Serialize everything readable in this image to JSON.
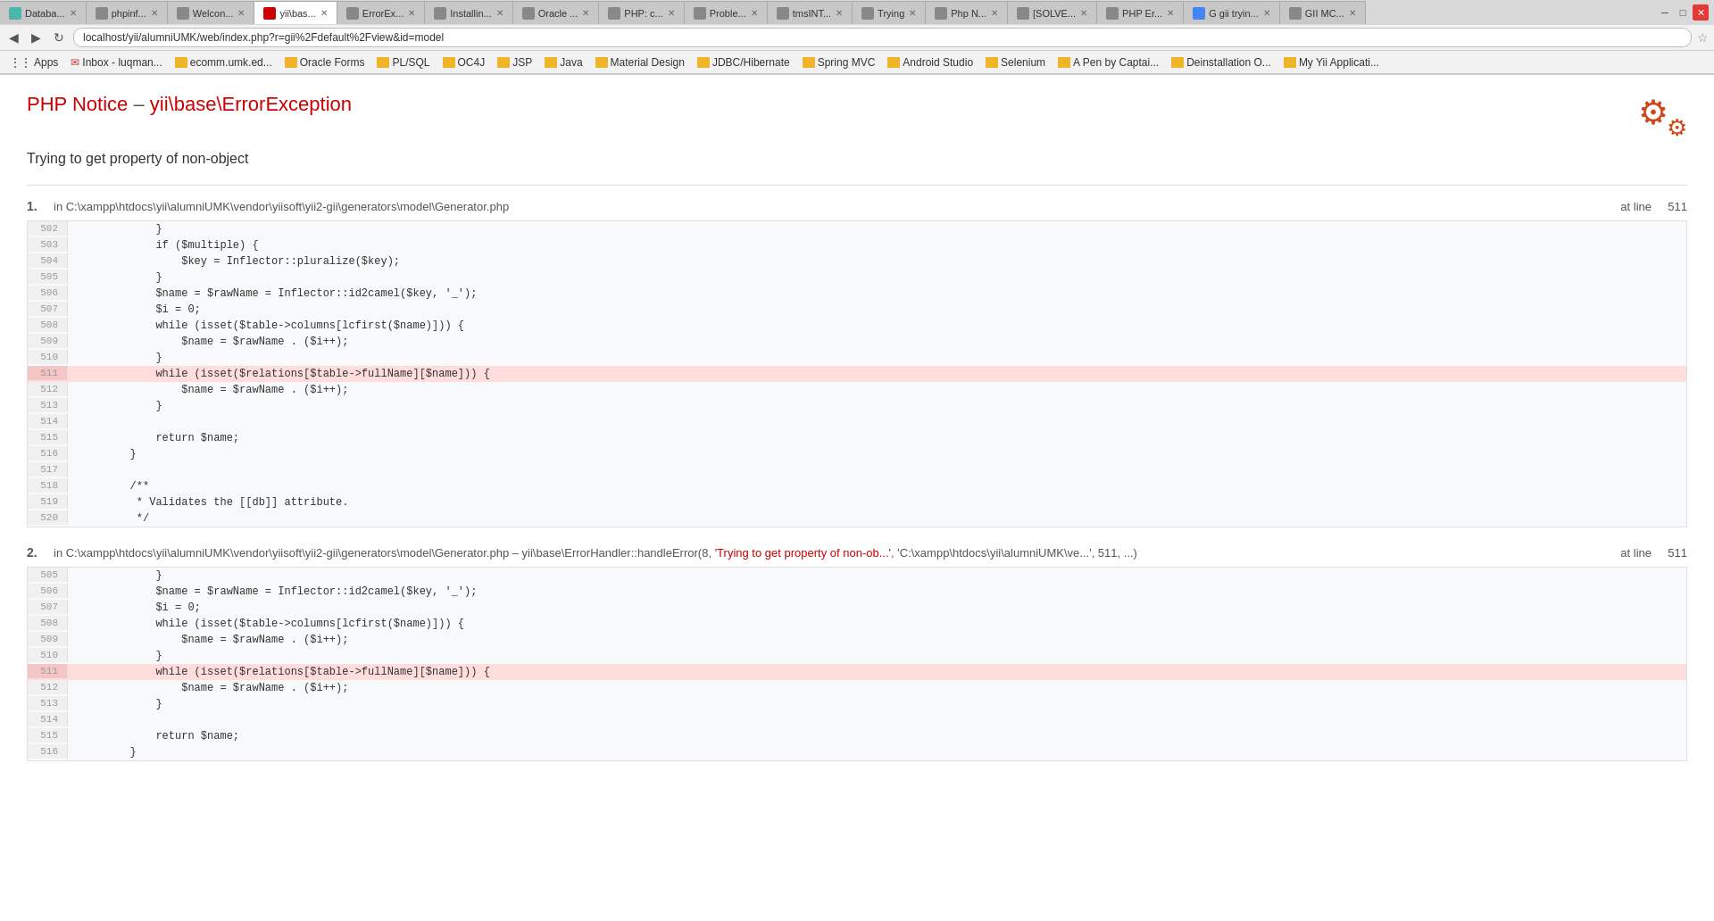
{
  "browser": {
    "url": "localhost/yii/alumniUMK/web/index.php?r=gii%2Fdefault%2Fview&id=model",
    "tabs": [
      {
        "label": "Databa...",
        "active": false,
        "color": "#4db6ac"
      },
      {
        "label": "phpinf...",
        "active": false,
        "color": "#888"
      },
      {
        "label": "Welcon...",
        "active": false,
        "color": "#888"
      },
      {
        "label": "yii\\bas...",
        "active": true,
        "color": "#cc0000"
      },
      {
        "label": "ErrorEx...",
        "active": false,
        "color": "#888"
      },
      {
        "label": "Installin...",
        "active": false,
        "color": "#888"
      },
      {
        "label": "Oracle ...",
        "active": false,
        "color": "#888"
      },
      {
        "label": "PHP: c...",
        "active": false,
        "color": "#888"
      },
      {
        "label": "Proble...",
        "active": false,
        "color": "#888"
      },
      {
        "label": "tmsINT...",
        "active": false,
        "color": "#888"
      },
      {
        "label": "Trying",
        "active": false,
        "color": "#888"
      },
      {
        "label": "Php N...",
        "active": false,
        "color": "#888"
      },
      {
        "label": "[SOLVE...",
        "active": false,
        "color": "#888"
      },
      {
        "label": "PHP Er...",
        "active": false,
        "color": "#888"
      },
      {
        "label": "G gii tryin...",
        "active": false,
        "color": "#888"
      },
      {
        "label": "GII MC...",
        "active": false,
        "color": "#888"
      }
    ],
    "bookmarks": [
      {
        "label": "Apps",
        "type": "text"
      },
      {
        "label": "Inbox - luqman...",
        "type": "mail"
      },
      {
        "label": "ecomm.umk.ed...",
        "type": "folder"
      },
      {
        "label": "Oracle Forms",
        "type": "folder"
      },
      {
        "label": "PL/SQL",
        "type": "folder"
      },
      {
        "label": "OC4J",
        "type": "folder"
      },
      {
        "label": "JSP",
        "type": "folder"
      },
      {
        "label": "Java",
        "type": "folder"
      },
      {
        "label": "Material Design",
        "type": "folder"
      },
      {
        "label": "JDBC/Hibernate",
        "type": "folder"
      },
      {
        "label": "Spring MVC",
        "type": "folder"
      },
      {
        "label": "Android Studio",
        "type": "folder"
      },
      {
        "label": "Selenium",
        "type": "folder"
      },
      {
        "label": "A Pen by Captai...",
        "type": "folder"
      },
      {
        "label": "Deinstallation O...",
        "type": "folder"
      },
      {
        "label": "My Yii Applicati...",
        "type": "folder"
      }
    ]
  },
  "page": {
    "error_title_prefix": "PHP Notice",
    "error_title_dash": " – ",
    "error_title_exception": "yii\\base\\ErrorException",
    "error_message": "Trying to get property of non-object",
    "stack_items": [
      {
        "number": "1.",
        "file": "in C:\\xampp\\htdocs\\yii\\alumniUMK\\vendor\\yiisoft\\yii2-gii\\generators\\model\\Generator.php",
        "at_line_label": "at line",
        "line_number": "511",
        "function_call": null,
        "code_lines": [
          {
            "num": "502",
            "content": "            }",
            "highlight": false
          },
          {
            "num": "503",
            "content": "            if ($multiple) {",
            "highlight": false
          },
          {
            "num": "504",
            "content": "                $key = Inflector::pluralize($key);",
            "highlight": false
          },
          {
            "num": "505",
            "content": "            }",
            "highlight": false
          },
          {
            "num": "506",
            "content": "            $name = $rawName = Inflector::id2camel($key, '_');",
            "highlight": false
          },
          {
            "num": "507",
            "content": "            $i = 0;",
            "highlight": false
          },
          {
            "num": "508",
            "content": "            while (isset($table->columns[lcfirst($name)])) {",
            "highlight": false
          },
          {
            "num": "509",
            "content": "                $name = $rawName . ($i++);",
            "highlight": false
          },
          {
            "num": "510",
            "content": "            }",
            "highlight": false
          },
          {
            "num": "511",
            "content": "            while (isset($relations[$table->fullName][$name])) {",
            "highlight": true
          },
          {
            "num": "512",
            "content": "                $name = $rawName . ($i++);",
            "highlight": false
          },
          {
            "num": "513",
            "content": "            }",
            "highlight": false
          },
          {
            "num": "514",
            "content": "",
            "highlight": false
          },
          {
            "num": "515",
            "content": "            return $name;",
            "highlight": false
          },
          {
            "num": "516",
            "content": "        }",
            "highlight": false
          },
          {
            "num": "517",
            "content": "",
            "highlight": false
          },
          {
            "num": "518",
            "content": "        /**",
            "highlight": false
          },
          {
            "num": "519",
            "content": "         * Validates the [[db]] attribute.",
            "highlight": false
          },
          {
            "num": "520",
            "content": "         */",
            "highlight": false
          }
        ]
      },
      {
        "number": "2.",
        "file": "in C:\\xampp\\htdocs\\yii\\alumniUMK\\vendor\\yiisoft\\yii2-gii\\generators\\model\\Generator.php",
        "separator": " – ",
        "function_call": "yii\\base\\ErrorHandler::handleError(8, 'Trying to get property of non-ob...', 'C:\\xampp\\htdocs\\yii\\alumniUMK\\ve...', 511, ...)",
        "function_call_error_text": "'Trying to get property of non-ob...'",
        "at_line_label": "at line",
        "line_number": "511",
        "code_lines": [
          {
            "num": "505",
            "content": "            }",
            "highlight": false
          },
          {
            "num": "506",
            "content": "            $name = $rawName = Inflector::id2camel($key, '_');",
            "highlight": false
          },
          {
            "num": "507",
            "content": "            $i = 0;",
            "highlight": false
          },
          {
            "num": "508",
            "content": "            while (isset($table->columns[lcfirst($name)])) {",
            "highlight": false
          },
          {
            "num": "509",
            "content": "                $name = $rawName . ($i++);",
            "highlight": false
          },
          {
            "num": "510",
            "content": "            }",
            "highlight": false
          },
          {
            "num": "511",
            "content": "            while (isset($relations[$table->fullName][$name])) {",
            "highlight": true
          },
          {
            "num": "512",
            "content": "                $name = $rawName . ($i++);",
            "highlight": false
          },
          {
            "num": "513",
            "content": "            }",
            "highlight": false
          },
          {
            "num": "514",
            "content": "",
            "highlight": false
          },
          {
            "num": "515",
            "content": "            return $name;",
            "highlight": false
          },
          {
            "num": "516",
            "content": "        }",
            "highlight": false
          }
        ]
      }
    ]
  }
}
